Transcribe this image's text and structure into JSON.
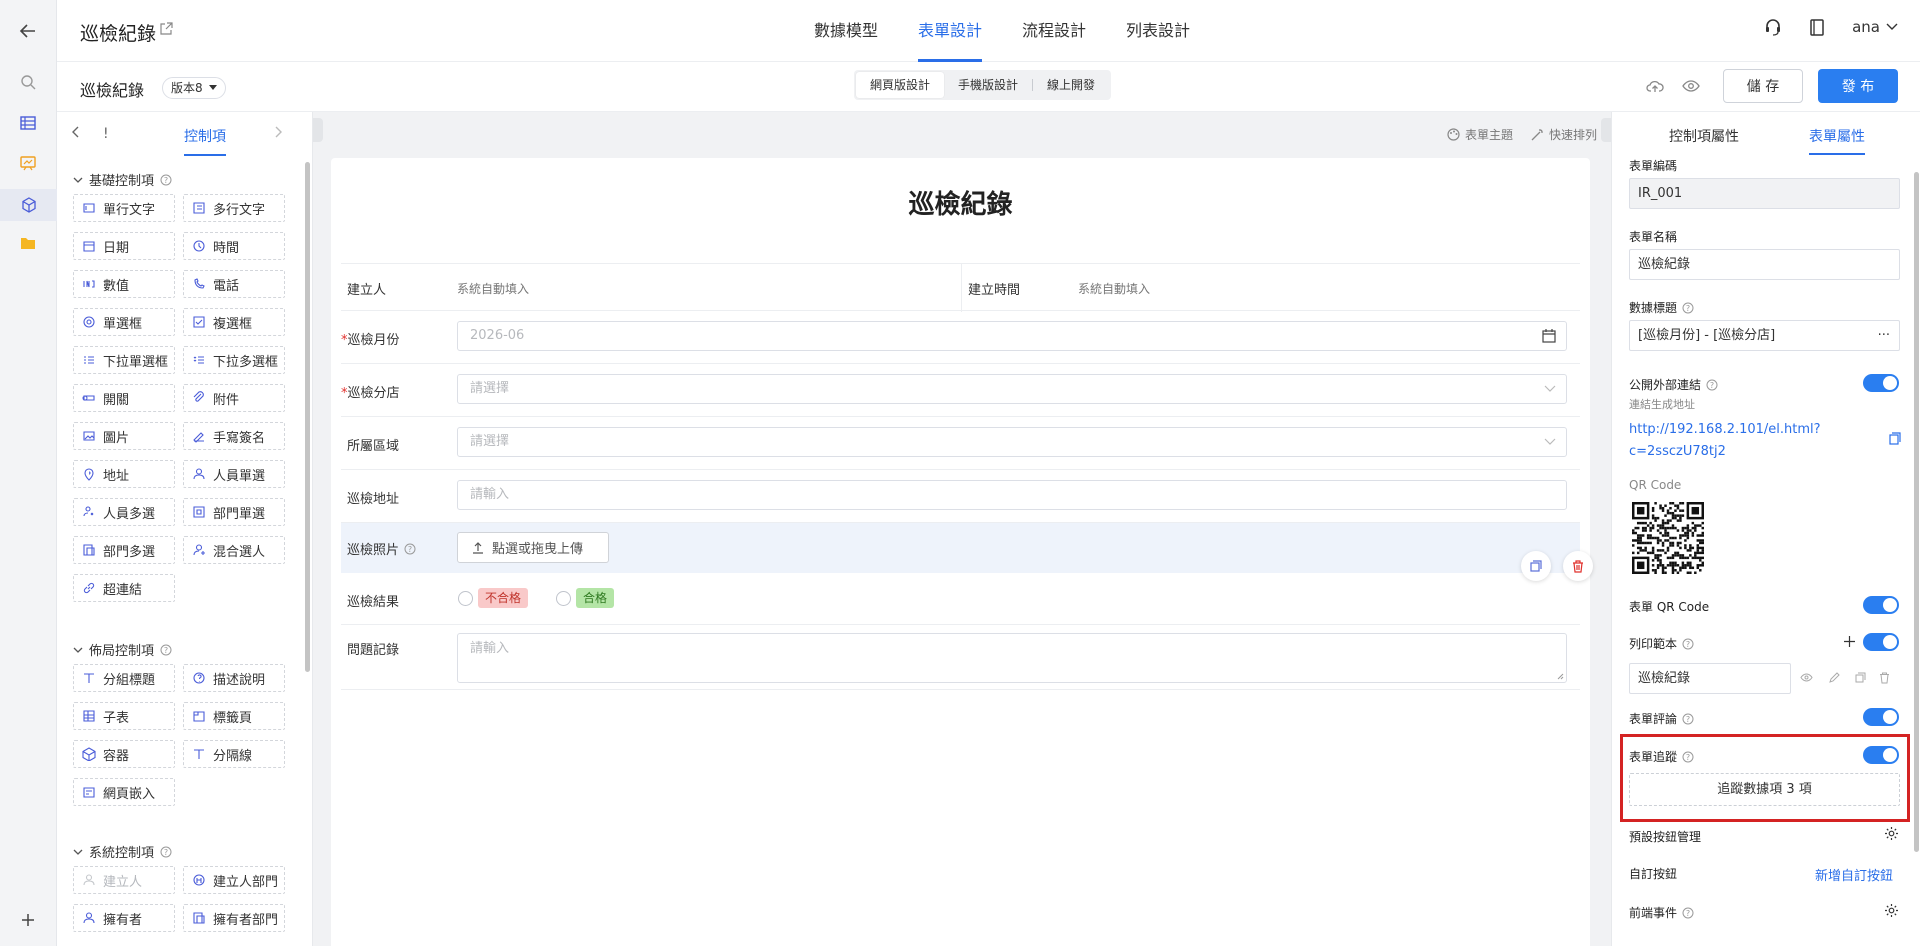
{
  "header": {
    "app_title": "巡檢紀錄",
    "nav_tabs": [
      "數據模型",
      "表單設計",
      "流程設計",
      "列表設計"
    ],
    "active_tab": "表單設計",
    "user": "ana"
  },
  "toolbar": {
    "form_name": "巡檢紀錄",
    "version": "版本8",
    "modes": [
      "網頁版設計",
      "手機版設計",
      "線上開發"
    ],
    "save_label": "儲 存",
    "publish_label": "發 布"
  },
  "left_panel": {
    "tab_prev": "!",
    "tab_active": "控制項",
    "groups": [
      {
        "title": "基礎控制項",
        "items": [
          "單行文字",
          "多行文字",
          "日期",
          "時間",
          "數值",
          "電話",
          "單選框",
          "複選框",
          "下拉單選框",
          "下拉多選框",
          "開關",
          "附件",
          "圖片",
          "手寫簽名",
          "地址",
          "人員單選",
          "人員多選",
          "部門單選",
          "部門多選",
          "混合選人",
          "超連結"
        ]
      },
      {
        "title": "佈局控制項",
        "items": [
          "分組標題",
          "描述說明",
          "子表",
          "標籤頁",
          "容器",
          "分隔線",
          "網頁嵌入"
        ]
      },
      {
        "title": "系統控制項",
        "items": [
          "建立人",
          "建立人部門",
          "擁有者",
          "擁有者部門"
        ]
      }
    ]
  },
  "canvas": {
    "actions": [
      "表單主題",
      "快速排列"
    ],
    "form_title": "巡檢紀錄",
    "fields": {
      "creator_label": "建立人",
      "creator_value": "系統自動填入",
      "created_time_label": "建立時間",
      "created_time_value": "系統自動填入",
      "month_label": "巡檢月份",
      "month_placeholder": "2026-06",
      "store_label": "巡檢分店",
      "store_placeholder": "請選擇",
      "region_label": "所屬區域",
      "region_placeholder": "請選擇",
      "address_label": "巡檢地址",
      "address_placeholder": "請輸入",
      "photo_label": "巡檢照片",
      "upload_label": "點選或拖曳上傳",
      "result_label": "巡檢結果",
      "result_fail": "不合格",
      "result_pass": "合格",
      "issue_label": "問題記錄",
      "issue_placeholder": "請輸入"
    }
  },
  "right_panel": {
    "tabs": [
      "控制項屬性",
      "表單屬性"
    ],
    "active_tab": "表單屬性",
    "form_code_label": "表單編碼",
    "form_code": "IR_001",
    "form_name_label": "表單名稱",
    "form_name": "巡檢紀錄",
    "data_title_label": "數據標題",
    "data_title": "[巡檢月份] - [巡檢分店]",
    "public_link_label": "公開外部連結",
    "public_link_sub": "連結生成地址",
    "public_link_url": "http://192.168.2.101/el.html?c=2ssczU78tj2",
    "qr_label": "QR Code",
    "form_qr_label": "表單 QR Code",
    "print_label": "列印範本",
    "print_template": "巡檢紀錄",
    "comment_label": "表單評論",
    "trace_label": "表單追蹤",
    "trace_button": "追蹤數據項 3 項",
    "default_btn_label": "預設按鈕管理",
    "custom_btn_label": "自訂按鈕",
    "custom_btn_link": "新增自訂按鈕",
    "frontend_event_label": "前端事件",
    "toggles": {
      "public_link": true,
      "form_qr": true,
      "print": true,
      "comment": true,
      "trace": true
    }
  },
  "colors": {
    "accent": "#2a7ef0",
    "highlight": "#d42323"
  }
}
